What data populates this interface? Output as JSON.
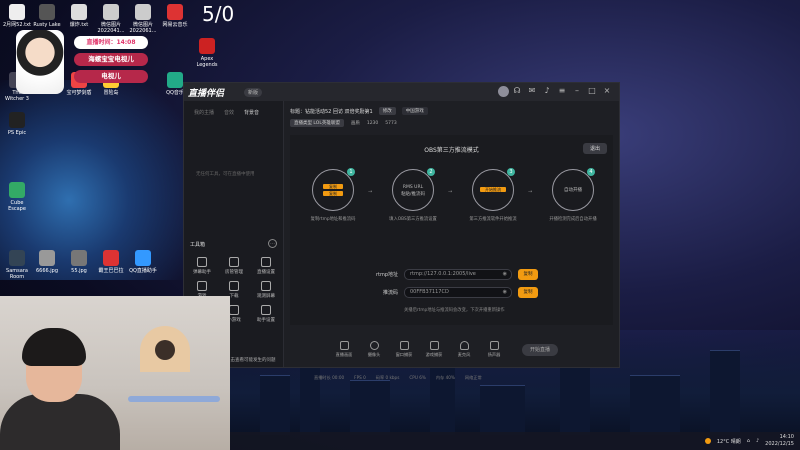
{
  "overlay": {
    "live_time": "直播时间：14:08",
    "pill1": "海螺宝宝电视儿",
    "pill2": "电视儿",
    "big_number": "5/0"
  },
  "desktop_icons": [
    "2月网52.txt",
    "Rusty Lake",
    "爆炸.txt",
    "微信图片2022041...",
    "微信图片2022061...",
    "网易云音乐",
    "Apex Legends",
    "The Witcher 3",
    "宝可梦剑盾",
    "冒险岛",
    "QQ音乐",
    "PS Epic",
    "Cube Escape",
    "Samsara Room",
    "6666.jpg",
    "55.jpg",
    "霸王巴巴拉",
    "QQ直播助手"
  ],
  "app": {
    "logo": "直播伴侣",
    "logo_badge": "新版",
    "side_tabs": [
      "我的主播",
      "音效",
      "背景音"
    ],
    "side_hint": "无任何工具，可在直播中使用",
    "tools_title": "工具箱",
    "tools": [
      "弹幕助手",
      "房管管理",
      "直播设置",
      "游戏",
      "下载",
      "观测屏幕",
      "小游戏",
      "",
      "助手设置"
    ],
    "side_footer": "点击查看可能发生的问题",
    "info": {
      "title_label": "标题：钻能活动52 回访 双倍奖励第1",
      "edit_chip": "修改",
      "category_chip": "中国游戏",
      "category2": "直播类型 LOL英雄联盟",
      "quality": "画质",
      "viewers": "1230",
      "gift": "5773"
    },
    "stage": {
      "mode_title": "OBS第三方推流模式",
      "exit": "退出",
      "steps": [
        {
          "num": "1",
          "line1": "复制",
          "line2": "复制",
          "desc": "复制rtmp地址和推流码"
        },
        {
          "num": "2",
          "line1": "RMS URL",
          "line2": "粘贴/推流码",
          "desc": "填入OBS第三方推流设置"
        },
        {
          "num": "3",
          "line1": "开始推流",
          "line2": "",
          "desc": "第三方推流软件开始推流"
        },
        {
          "num": "4",
          "line1": "自动开播",
          "line2": "",
          "desc": "开播检测完成后自动开播"
        }
      ],
      "rtmp_label": "rtmp地址",
      "rtmp_value": "rtmp://127.0.0.1:2005/live",
      "key_label": "推流码",
      "key_value": "00FFB37117CD",
      "copy": "复制",
      "note": "关播后rtmp地址与推流码会改变，下次开播重新操作"
    },
    "bottom_tools": [
      "直播画面",
      "摄像头",
      "窗口捕获",
      "游戏捕获",
      "麦克风",
      "扬声器"
    ],
    "start_button": "开始直播",
    "status": [
      "直播时长 00:00",
      "FPS 0",
      "码率 0 kbps",
      "CPU 6%",
      "内存 40%",
      "网络正常"
    ]
  },
  "taskbar": {
    "weather": "12°C 晴朗",
    "time": "14:10",
    "date": "2022/12/15"
  }
}
